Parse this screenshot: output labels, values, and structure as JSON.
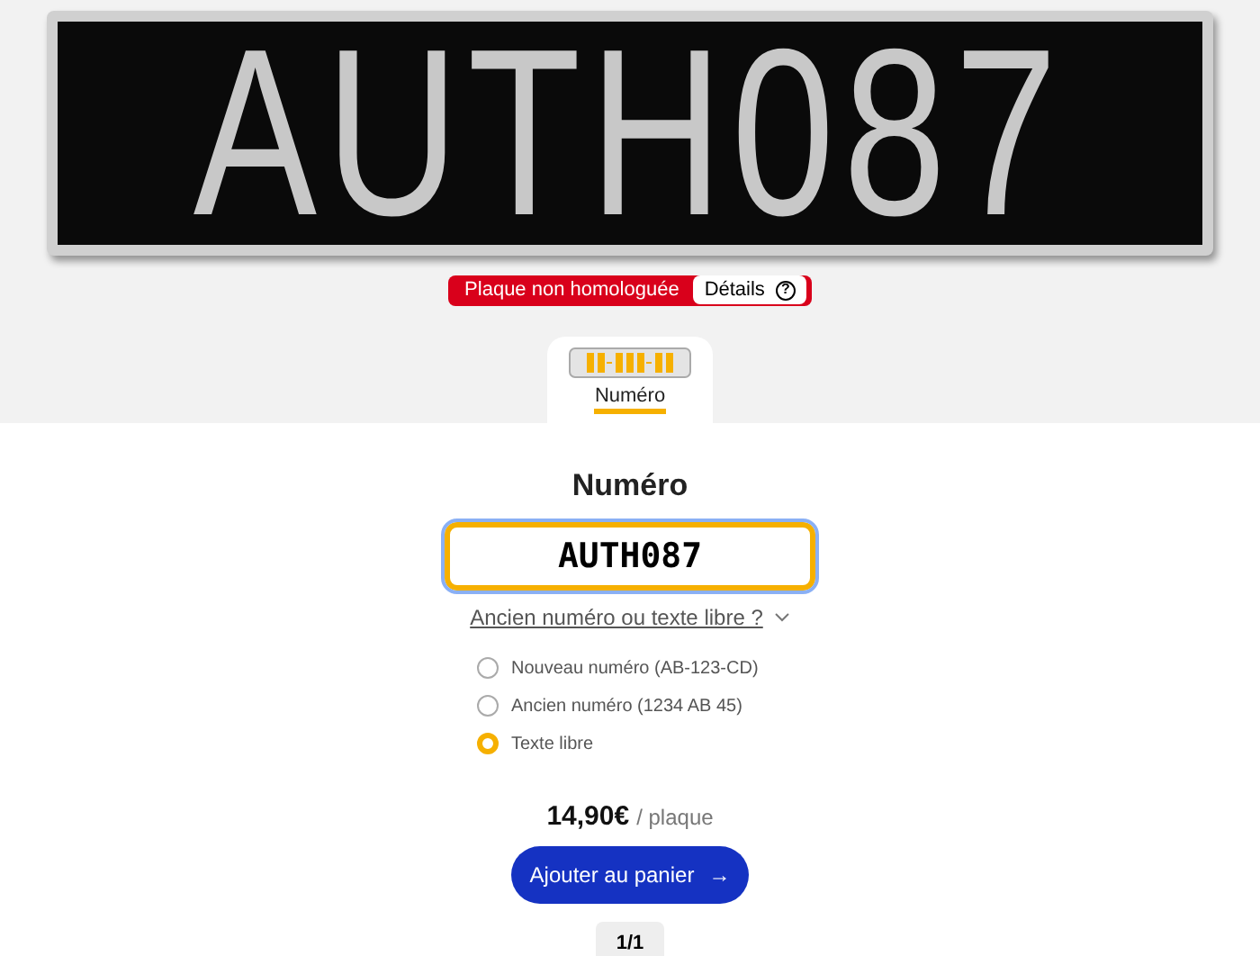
{
  "plate": {
    "text": "AUTH087"
  },
  "warning": {
    "label": "Plaque non homologuée",
    "details": "Détails",
    "details_icon": "?"
  },
  "tabs": [
    {
      "label": "Numéro",
      "selected": true
    }
  ],
  "form": {
    "title": "Numéro",
    "value": "AUTH087",
    "toggle": "Ancien numéro ou texte libre ?",
    "options": [
      {
        "label": "Nouveau numéro (AB-123-CD)",
        "selected": false
      },
      {
        "label": "Ancien numéro (1234 AB 45)",
        "selected": false
      },
      {
        "label": "Texte libre",
        "selected": true
      }
    ]
  },
  "price": {
    "amount": "14,90€",
    "unit": "/ plaque"
  },
  "cart_button": {
    "label": "Ajouter au panier",
    "arrow": "→"
  },
  "pager": "1/1"
}
